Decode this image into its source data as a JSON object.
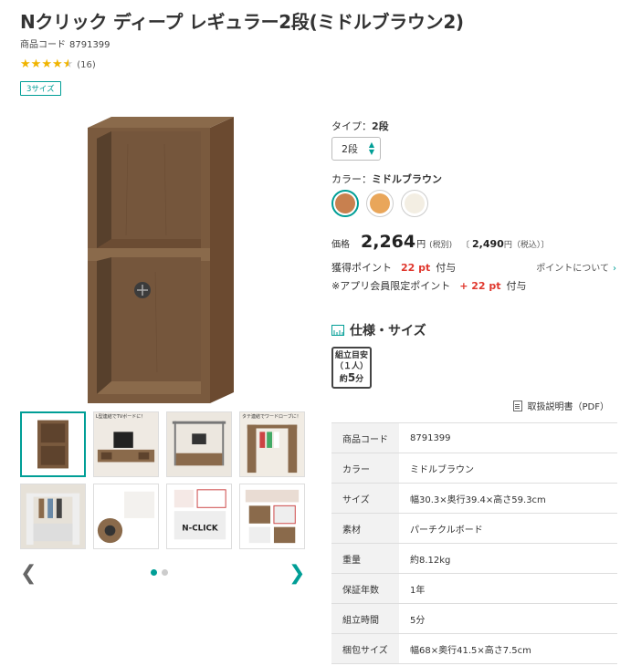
{
  "product": {
    "title": "Nクリック ディープ レギュラー2段(ミドルブラウン2)",
    "code_label": "商品コード",
    "code": "8791399",
    "rating": 4.5,
    "review_count": "(16)",
    "size_badge": "3サイズ"
  },
  "options": {
    "type_label": "タイプ：",
    "type_value": "2段",
    "select_value": "2段",
    "color_label": "カラー：",
    "color_value": "ミドルブラウン",
    "swatches": [
      {
        "name": "ミドルブラウン",
        "color": "#c8804f"
      },
      {
        "name": "ナチュラル",
        "color": "#e9a65a"
      },
      {
        "name": "ホワイト",
        "color": "#f3eee3"
      }
    ]
  },
  "price": {
    "label": "価格",
    "amount": "2,264",
    "yen": "円",
    "tax_excluded": "(税別)",
    "tax_included_open": "〔",
    "tax_included_amount": "2,490",
    "tax_included_suffix": "円（税込）〕"
  },
  "points": {
    "label": "獲得ポイント",
    "value": "22 pt",
    "suffix": "付与",
    "about_link": "ポイントについて",
    "app_label": "※アプリ会員限定ポイント",
    "app_value": "+ 22 pt",
    "app_suffix": "付与"
  },
  "spec": {
    "heading": "仕様・サイズ",
    "assembly_line1": "組立目安",
    "assembly_line2": "（１人）",
    "assembly_line3": "約",
    "assembly_minutes": "5",
    "assembly_unit": "分",
    "manual_link": "取扱説明書（PDF）",
    "rows": [
      {
        "key": "商品コード",
        "value": "8791399"
      },
      {
        "key": "カラー",
        "value": "ミドルブラウン"
      },
      {
        "key": "サイズ",
        "value": "幅30.3×奥行39.4×高さ59.3cm"
      },
      {
        "key": "素材",
        "value": "パーチクルボード"
      },
      {
        "key": "重量",
        "value": "約8.12kg"
      },
      {
        "key": "保証年数",
        "value": "1年"
      },
      {
        "key": "組立時間",
        "value": "5分"
      },
      {
        "key": "梱包サイズ",
        "value": "幅68×奥行41.5×高さ7.5cm"
      }
    ]
  },
  "gallery": {
    "thumb_count": 8,
    "nav_prev_icon": "chevron-left-icon",
    "nav_next_icon": "chevron-right-icon",
    "thumb_captions": [
      "",
      "L型連結でTVボードに！",
      "",
      "タテ連結でワードローブに！",
      "",
      "",
      "",
      ""
    ],
    "thumb_promo_text": "N-CLICK"
  }
}
